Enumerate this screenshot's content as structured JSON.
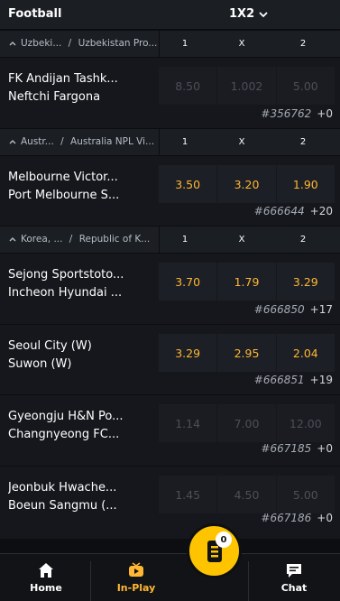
{
  "header": {
    "sport": "Football",
    "market": "1X2"
  },
  "columns": {
    "one": "1",
    "draw": "X",
    "two": "2"
  },
  "leagues": [
    {
      "country": "Uzbeki...",
      "name": "Uzbekistan Pro..."
    },
    {
      "country": "Austr...",
      "name": "Australia NPL Vi..."
    },
    {
      "country": "Korea, ...",
      "name": "Republic of K..."
    }
  ],
  "matches": [
    {
      "home": "FK Andijan Tashk...",
      "away": "Neftchi Fargona",
      "odds": [
        "8.50",
        "1.002",
        "5.00"
      ],
      "locked": true,
      "id": "#356762",
      "more": "+0"
    },
    {
      "home": "Melbourne Victor...",
      "away": "Port Melbourne S...",
      "odds": [
        "3.50",
        "3.20",
        "1.90"
      ],
      "locked": false,
      "id": "#666644",
      "more": "+20"
    },
    {
      "home": "Sejong Sportstoto...",
      "away": "Incheon Hyundai ...",
      "odds": [
        "3.70",
        "1.79",
        "3.29"
      ],
      "locked": false,
      "id": "#666850",
      "more": "+17"
    },
    {
      "home": "Seoul City (W)",
      "away": "Suwon (W)",
      "odds": [
        "3.29",
        "2.95",
        "2.04"
      ],
      "locked": false,
      "id": "#666851",
      "more": "+19"
    },
    {
      "home": "Gyeongju H&N Po...",
      "away": "Changnyeong FC...",
      "odds": [
        "1.14",
        "7.00",
        "12.00"
      ],
      "locked": true,
      "id": "#667185",
      "more": "+0"
    },
    {
      "home": "Jeonbuk Hwache...",
      "away": "Boeun Sangmu (...",
      "odds": [
        "1.45",
        "4.50",
        "5.00"
      ],
      "locked": true,
      "id": "#667186",
      "more": "+0"
    }
  ],
  "betslip": {
    "count": "0"
  },
  "nav": {
    "home": "Home",
    "inplay": "In-Play",
    "chat": "Chat"
  },
  "colors": {
    "accent": "#ffb733",
    "fab": "#ffc400",
    "background": "#15171c"
  }
}
